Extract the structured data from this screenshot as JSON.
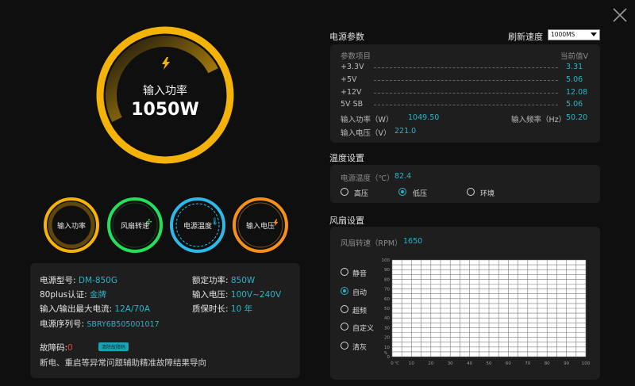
{
  "window": {
    "close_icon": "close-icon"
  },
  "big_gauge": {
    "label": "输入功率",
    "value": "1050W",
    "icon": "bolt-icon",
    "color": "#f5b30a",
    "fill_fraction": 0.5
  },
  "small_gauges": [
    {
      "label": "输入功率",
      "color": "#f5b30a",
      "icon": "none"
    },
    {
      "label": "风扇转速",
      "color": "#22e05a",
      "icon": "fan-icon"
    },
    {
      "label": "电源温度",
      "color": "#2db8e8",
      "icon": "thermometer-icon"
    },
    {
      "label": "输入电压",
      "color": "#f5901a",
      "icon": "bolt-icon"
    }
  ],
  "info": {
    "model_label": "电源型号:",
    "model_value": "DM-850G",
    "rated_label": "额定功率:",
    "rated_value": "850W",
    "cert_label": "80plus认证:",
    "cert_value": "金牌",
    "voltage_label": "输入电压:",
    "voltage_value": "100V~240V",
    "current_label": "输入/输出最大电流:",
    "current_value": "12A/70A",
    "warranty_label": "质保时长:",
    "warranty_value": "10 年",
    "serial_label": "电源序列号:",
    "serial_value": "SBRY6B505001017",
    "fault_label": "故障码:",
    "fault_value": "0",
    "fault_badge": "清除故障码",
    "fault_desc": "断电、重启等异常问题辅助精准故障结果导向"
  },
  "power_params": {
    "title": "电源参数",
    "refresh_label": "刷新速度",
    "refresh_value": "1000MS",
    "col_item": "参数项目",
    "col_current": "当前值V",
    "rows": [
      {
        "name": "+3.3V",
        "value": "3.31"
      },
      {
        "name": "+5V",
        "value": "5.06"
      },
      {
        "name": "+12V",
        "value": "12.08"
      },
      {
        "name": "5V SB",
        "value": "5.06"
      }
    ],
    "input_power_label": "输入功率（W）",
    "input_power_value": "1049.50",
    "input_freq_label": "输入频率（Hz）",
    "input_freq_value": "50.20",
    "input_voltage_label": "输入电压（V）",
    "input_voltage_value": "221.0"
  },
  "temperature": {
    "title": "温度设置",
    "temp_label": "电源温度（℃）",
    "temp_value": "82.4",
    "options": [
      {
        "label": "高压",
        "selected": false
      },
      {
        "label": "低压",
        "selected": true
      },
      {
        "label": "环境",
        "selected": false
      }
    ]
  },
  "fan": {
    "title": "风扇设置",
    "speed_label": "风扇转速（RPM）",
    "speed_value": "1650",
    "modes": [
      {
        "label": "静音",
        "selected": false
      },
      {
        "label": "自动",
        "selected": true
      },
      {
        "label": "超频",
        "selected": false
      },
      {
        "label": "自定义",
        "selected": false
      },
      {
        "label": "清灰",
        "selected": false
      }
    ]
  },
  "chart_data": {
    "type": "line",
    "x_ticks": [
      "0",
      "10",
      "20",
      "30",
      "40",
      "50",
      "60",
      "70",
      "80",
      "90",
      "100"
    ],
    "y_ticks": [
      "100",
      "90",
      "80",
      "70",
      "60",
      "50",
      "40",
      "30",
      "20",
      "10",
      "0"
    ],
    "x_unit": "℃",
    "y_unit": "%",
    "xlim": [
      0,
      100
    ],
    "ylim": [
      0,
      100
    ],
    "grid": true,
    "series": []
  }
}
